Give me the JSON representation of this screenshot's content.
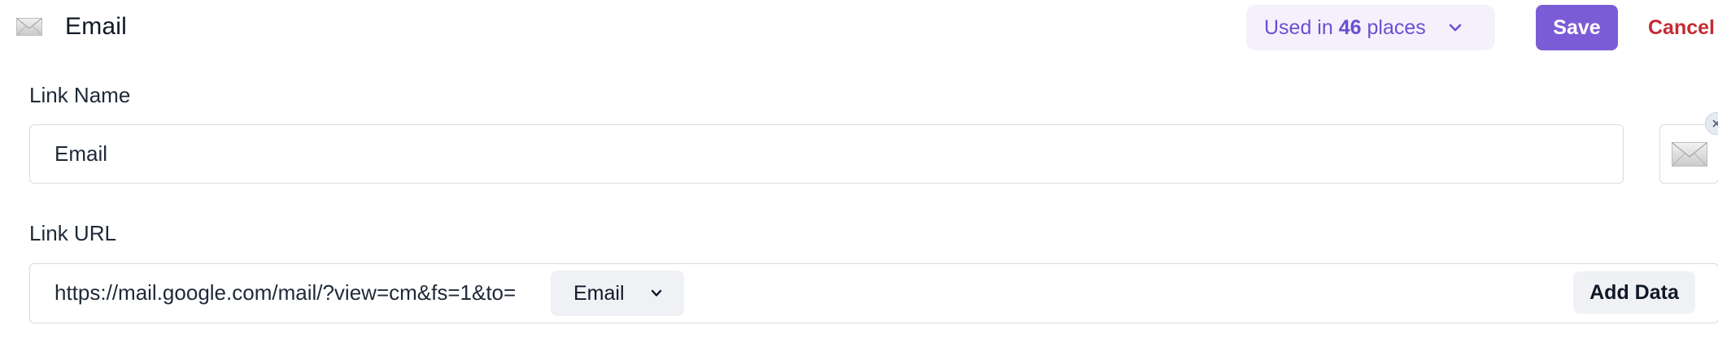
{
  "header": {
    "icon": "mail-icon",
    "title": "Email",
    "usage": {
      "prefix": "Used in",
      "count": "46",
      "suffix": "places"
    },
    "save_label": "Save",
    "cancel_label": "Cancel"
  },
  "link_name": {
    "label": "Link Name",
    "value": "Email",
    "icon": "mail-icon"
  },
  "link_url": {
    "label": "Link URL",
    "value": "https://mail.google.com/mail/?view=cm&fs=1&to=",
    "data_chip": "Email",
    "add_data_label": "Add Data"
  },
  "colors": {
    "accent": "#7c5cd6",
    "usage_bg": "#f4f1fd",
    "usage_text": "#6a4fd1",
    "cancel": "#c52b35"
  }
}
